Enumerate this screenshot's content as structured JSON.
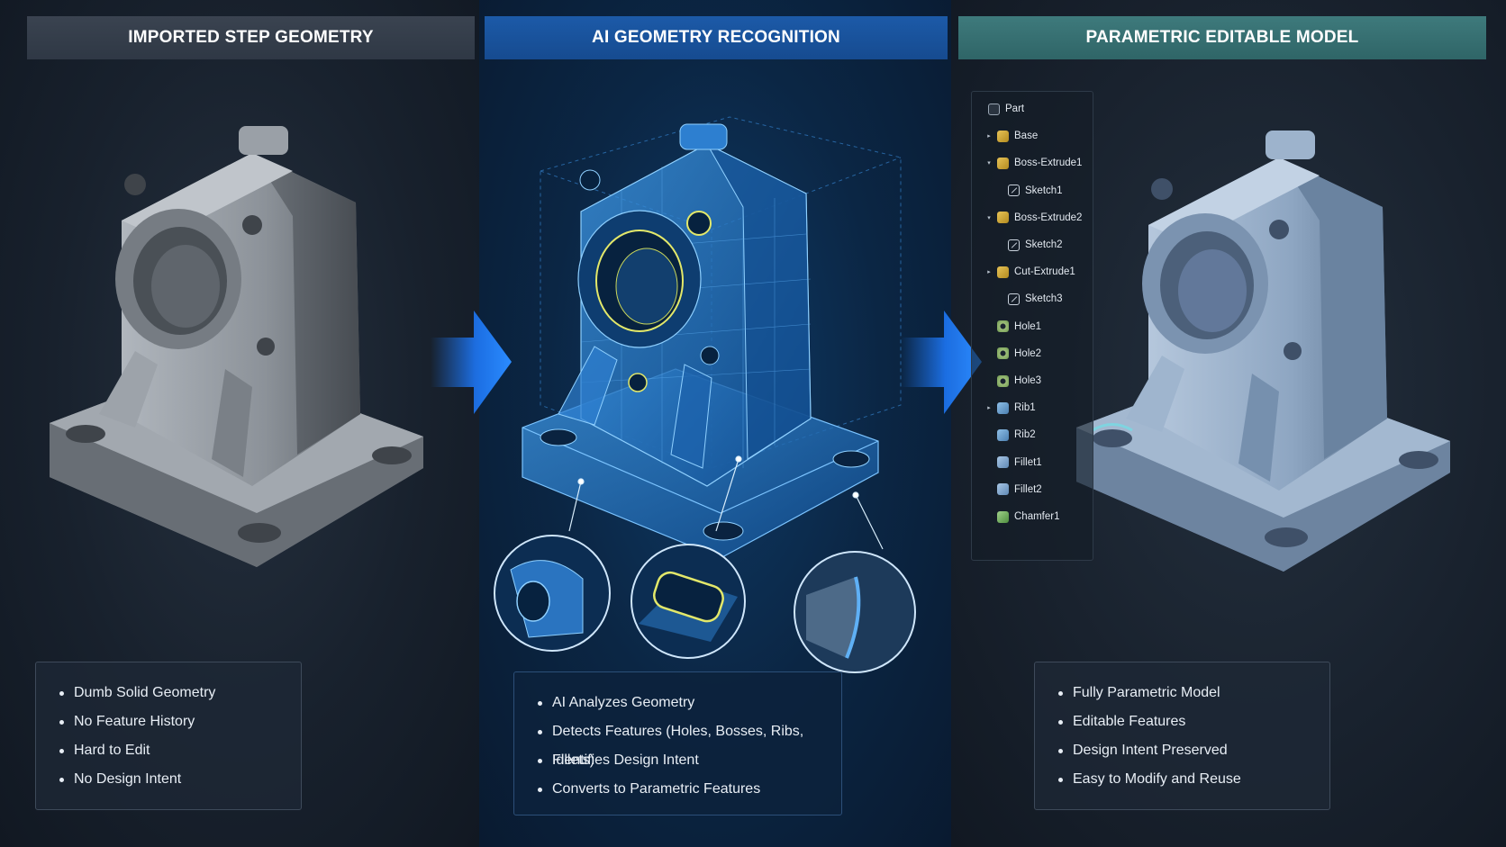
{
  "panels": {
    "left": {
      "title": "IMPORTED STEP GEOMETRY",
      "bullets": [
        "Dumb Solid Geometry",
        "No Feature History",
        "Hard to Edit",
        "No Design Intent"
      ]
    },
    "middle": {
      "title": "AI GEOMETRY RECOGNITION",
      "bullets": [
        "AI Analyzes Geometry",
        "Detects Features (Holes, Bosses, Ribs, Fillets)",
        "Identifies Design Intent",
        "Converts to Parametric Features"
      ]
    },
    "right": {
      "title": "PARAMETRIC EDITABLE MODEL",
      "bullets": [
        "Fully Parametric Model",
        "Editable Features",
        "Design Intent Preserved",
        "Easy to Modify and Reuse"
      ]
    }
  },
  "feature_tree": [
    {
      "label": "Part",
      "icon": "part-icon",
      "twisty": "none",
      "indent": 0
    },
    {
      "label": "Base",
      "icon": "extrude-icon",
      "twisty": "collapsed",
      "indent": 1
    },
    {
      "label": "Boss-Extrude1",
      "icon": "extrude-icon",
      "twisty": "expanded",
      "indent": 1
    },
    {
      "label": "Sketch1",
      "icon": "sketch-icon",
      "twisty": "none",
      "indent": 2
    },
    {
      "label": "Boss-Extrude2",
      "icon": "extrude-icon",
      "twisty": "expanded",
      "indent": 1
    },
    {
      "label": "Sketch2",
      "icon": "sketch-icon",
      "twisty": "none",
      "indent": 2
    },
    {
      "label": "Cut-Extrude1",
      "icon": "cut-icon",
      "twisty": "collapsed",
      "indent": 1
    },
    {
      "label": "Sketch3",
      "icon": "sketch-icon",
      "twisty": "none",
      "indent": 2
    },
    {
      "label": "Hole1",
      "icon": "hole-icon",
      "twisty": "none",
      "indent": 1
    },
    {
      "label": "Hole2",
      "icon": "hole-icon",
      "twisty": "none",
      "indent": 1
    },
    {
      "label": "Hole3",
      "icon": "hole-icon",
      "twisty": "none",
      "indent": 1
    },
    {
      "label": "Rib1",
      "icon": "rib-icon",
      "twisty": "collapsed",
      "indent": 1
    },
    {
      "label": "Rib2",
      "icon": "rib-icon",
      "twisty": "none",
      "indent": 1
    },
    {
      "label": "Fillet1",
      "icon": "fillet-icon",
      "twisty": "none",
      "indent": 1
    },
    {
      "label": "Fillet2",
      "icon": "fillet-icon",
      "twisty": "none",
      "indent": 1
    },
    {
      "label": "Chamfer1",
      "icon": "chamfer-icon",
      "twisty": "none",
      "indent": 1
    }
  ],
  "colors": {
    "left_banner": "#343d4a",
    "middle_banner": "#1a55a0",
    "right_banner": "#367072",
    "arrow": "#1e7bff",
    "grey_part": "#8e949b",
    "blue_wireframe": "#3a8fe0",
    "steel_blue_part": "#7f9bbd"
  }
}
